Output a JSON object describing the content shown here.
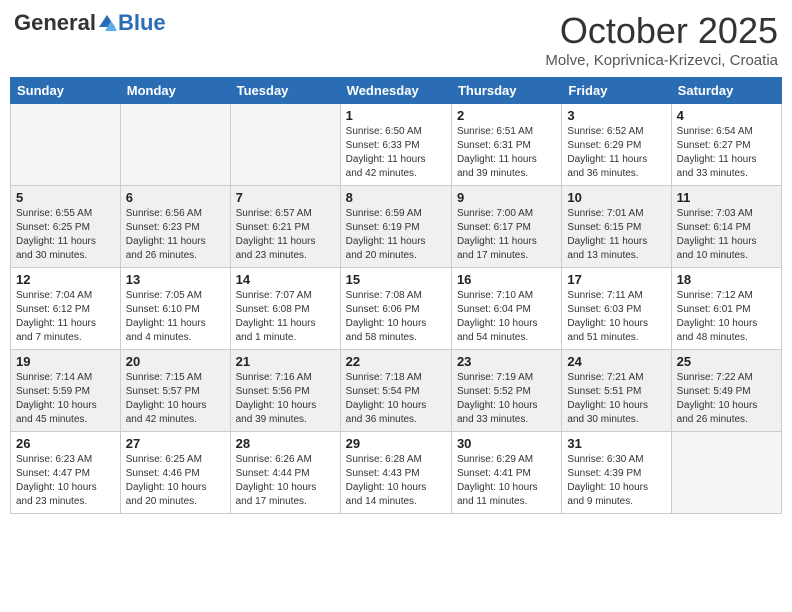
{
  "header": {
    "logo_general": "General",
    "logo_blue": "Blue",
    "month": "October 2025",
    "location": "Molve, Koprivnica-Krizevci, Croatia"
  },
  "weekdays": [
    "Sunday",
    "Monday",
    "Tuesday",
    "Wednesday",
    "Thursday",
    "Friday",
    "Saturday"
  ],
  "weeks": [
    [
      {
        "day": "",
        "info": ""
      },
      {
        "day": "",
        "info": ""
      },
      {
        "day": "",
        "info": ""
      },
      {
        "day": "1",
        "info": "Sunrise: 6:50 AM\nSunset: 6:33 PM\nDaylight: 11 hours\nand 42 minutes."
      },
      {
        "day": "2",
        "info": "Sunrise: 6:51 AM\nSunset: 6:31 PM\nDaylight: 11 hours\nand 39 minutes."
      },
      {
        "day": "3",
        "info": "Sunrise: 6:52 AM\nSunset: 6:29 PM\nDaylight: 11 hours\nand 36 minutes."
      },
      {
        "day": "4",
        "info": "Sunrise: 6:54 AM\nSunset: 6:27 PM\nDaylight: 11 hours\nand 33 minutes."
      }
    ],
    [
      {
        "day": "5",
        "info": "Sunrise: 6:55 AM\nSunset: 6:25 PM\nDaylight: 11 hours\nand 30 minutes."
      },
      {
        "day": "6",
        "info": "Sunrise: 6:56 AM\nSunset: 6:23 PM\nDaylight: 11 hours\nand 26 minutes."
      },
      {
        "day": "7",
        "info": "Sunrise: 6:57 AM\nSunset: 6:21 PM\nDaylight: 11 hours\nand 23 minutes."
      },
      {
        "day": "8",
        "info": "Sunrise: 6:59 AM\nSunset: 6:19 PM\nDaylight: 11 hours\nand 20 minutes."
      },
      {
        "day": "9",
        "info": "Sunrise: 7:00 AM\nSunset: 6:17 PM\nDaylight: 11 hours\nand 17 minutes."
      },
      {
        "day": "10",
        "info": "Sunrise: 7:01 AM\nSunset: 6:15 PM\nDaylight: 11 hours\nand 13 minutes."
      },
      {
        "day": "11",
        "info": "Sunrise: 7:03 AM\nSunset: 6:14 PM\nDaylight: 11 hours\nand 10 minutes."
      }
    ],
    [
      {
        "day": "12",
        "info": "Sunrise: 7:04 AM\nSunset: 6:12 PM\nDaylight: 11 hours\nand 7 minutes."
      },
      {
        "day": "13",
        "info": "Sunrise: 7:05 AM\nSunset: 6:10 PM\nDaylight: 11 hours\nand 4 minutes."
      },
      {
        "day": "14",
        "info": "Sunrise: 7:07 AM\nSunset: 6:08 PM\nDaylight: 11 hours\nand 1 minute."
      },
      {
        "day": "15",
        "info": "Sunrise: 7:08 AM\nSunset: 6:06 PM\nDaylight: 10 hours\nand 58 minutes."
      },
      {
        "day": "16",
        "info": "Sunrise: 7:10 AM\nSunset: 6:04 PM\nDaylight: 10 hours\nand 54 minutes."
      },
      {
        "day": "17",
        "info": "Sunrise: 7:11 AM\nSunset: 6:03 PM\nDaylight: 10 hours\nand 51 minutes."
      },
      {
        "day": "18",
        "info": "Sunrise: 7:12 AM\nSunset: 6:01 PM\nDaylight: 10 hours\nand 48 minutes."
      }
    ],
    [
      {
        "day": "19",
        "info": "Sunrise: 7:14 AM\nSunset: 5:59 PM\nDaylight: 10 hours\nand 45 minutes."
      },
      {
        "day": "20",
        "info": "Sunrise: 7:15 AM\nSunset: 5:57 PM\nDaylight: 10 hours\nand 42 minutes."
      },
      {
        "day": "21",
        "info": "Sunrise: 7:16 AM\nSunset: 5:56 PM\nDaylight: 10 hours\nand 39 minutes."
      },
      {
        "day": "22",
        "info": "Sunrise: 7:18 AM\nSunset: 5:54 PM\nDaylight: 10 hours\nand 36 minutes."
      },
      {
        "day": "23",
        "info": "Sunrise: 7:19 AM\nSunset: 5:52 PM\nDaylight: 10 hours\nand 33 minutes."
      },
      {
        "day": "24",
        "info": "Sunrise: 7:21 AM\nSunset: 5:51 PM\nDaylight: 10 hours\nand 30 minutes."
      },
      {
        "day": "25",
        "info": "Sunrise: 7:22 AM\nSunset: 5:49 PM\nDaylight: 10 hours\nand 26 minutes."
      }
    ],
    [
      {
        "day": "26",
        "info": "Sunrise: 6:23 AM\nSunset: 4:47 PM\nDaylight: 10 hours\nand 23 minutes."
      },
      {
        "day": "27",
        "info": "Sunrise: 6:25 AM\nSunset: 4:46 PM\nDaylight: 10 hours\nand 20 minutes."
      },
      {
        "day": "28",
        "info": "Sunrise: 6:26 AM\nSunset: 4:44 PM\nDaylight: 10 hours\nand 17 minutes."
      },
      {
        "day": "29",
        "info": "Sunrise: 6:28 AM\nSunset: 4:43 PM\nDaylight: 10 hours\nand 14 minutes."
      },
      {
        "day": "30",
        "info": "Sunrise: 6:29 AM\nSunset: 4:41 PM\nDaylight: 10 hours\nand 11 minutes."
      },
      {
        "day": "31",
        "info": "Sunrise: 6:30 AM\nSunset: 4:39 PM\nDaylight: 10 hours\nand 9 minutes."
      },
      {
        "day": "",
        "info": ""
      }
    ]
  ]
}
